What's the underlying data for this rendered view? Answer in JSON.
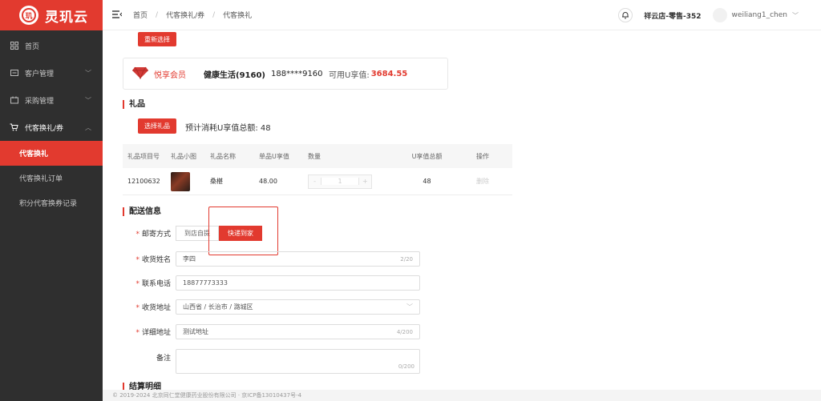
{
  "app": {
    "logo_text": "灵玑云",
    "logo_mark": "玑"
  },
  "sidebar": {
    "items": [
      {
        "label": "首页"
      },
      {
        "label": "客户管理"
      },
      {
        "label": "采购管理"
      },
      {
        "label": "代客换礼/券"
      }
    ],
    "sub_items": [
      {
        "label": "代客换礼"
      },
      {
        "label": "代客换礼订单"
      },
      {
        "label": "积分代客换券记录"
      }
    ]
  },
  "header": {
    "breadcrumbs": [
      "首页",
      "代客换礼/券",
      "代客换礼"
    ],
    "store": "祥云店-零售-352",
    "username": "weiliang1_chen"
  },
  "actions": {
    "reselect": "重新选择",
    "select_gift": "选择礼品"
  },
  "member": {
    "level": "悦享会员",
    "name": "健康生活(9160)",
    "phone": "188****9160",
    "balance_label": "可用U享值:",
    "balance": "3684.55"
  },
  "gifts": {
    "title": "礼品",
    "total_label": "预计消耗U享值总额: 48",
    "columns": [
      "礼品项目号",
      "礼品小图",
      "礼品名称",
      "单品U享值",
      "数量",
      "U享值总额",
      "操作"
    ],
    "rows": [
      {
        "id": "12100632",
        "name": "桑椹",
        "unit": "48.00",
        "qty": "1",
        "total": "48",
        "op": "删除"
      }
    ]
  },
  "delivery": {
    "title": "配送信息",
    "method_label": "邮寄方式",
    "options": [
      "到店自提",
      "快递到家"
    ],
    "name_label": "收货姓名",
    "name_value": "李四",
    "name_count": "2/20",
    "phone_label": "联系电话",
    "phone_value": "18877773333",
    "region_label": "收货地址",
    "region_value": "山西省 / 长治市 / 潞城区",
    "address_label": "详细地址",
    "address_value": "测试地址",
    "address_count": "4/200",
    "remark_label": "备注",
    "remark_count": "0/200",
    "next_section": "结算明细"
  },
  "footer": {
    "text": "© 2019-2024 北京同仁堂健康药业股份有限公司 · 京ICP备13010437号-4"
  },
  "colors": {
    "brand": "#e23a2f",
    "sidebar_bg": "#2f2f2f"
  }
}
